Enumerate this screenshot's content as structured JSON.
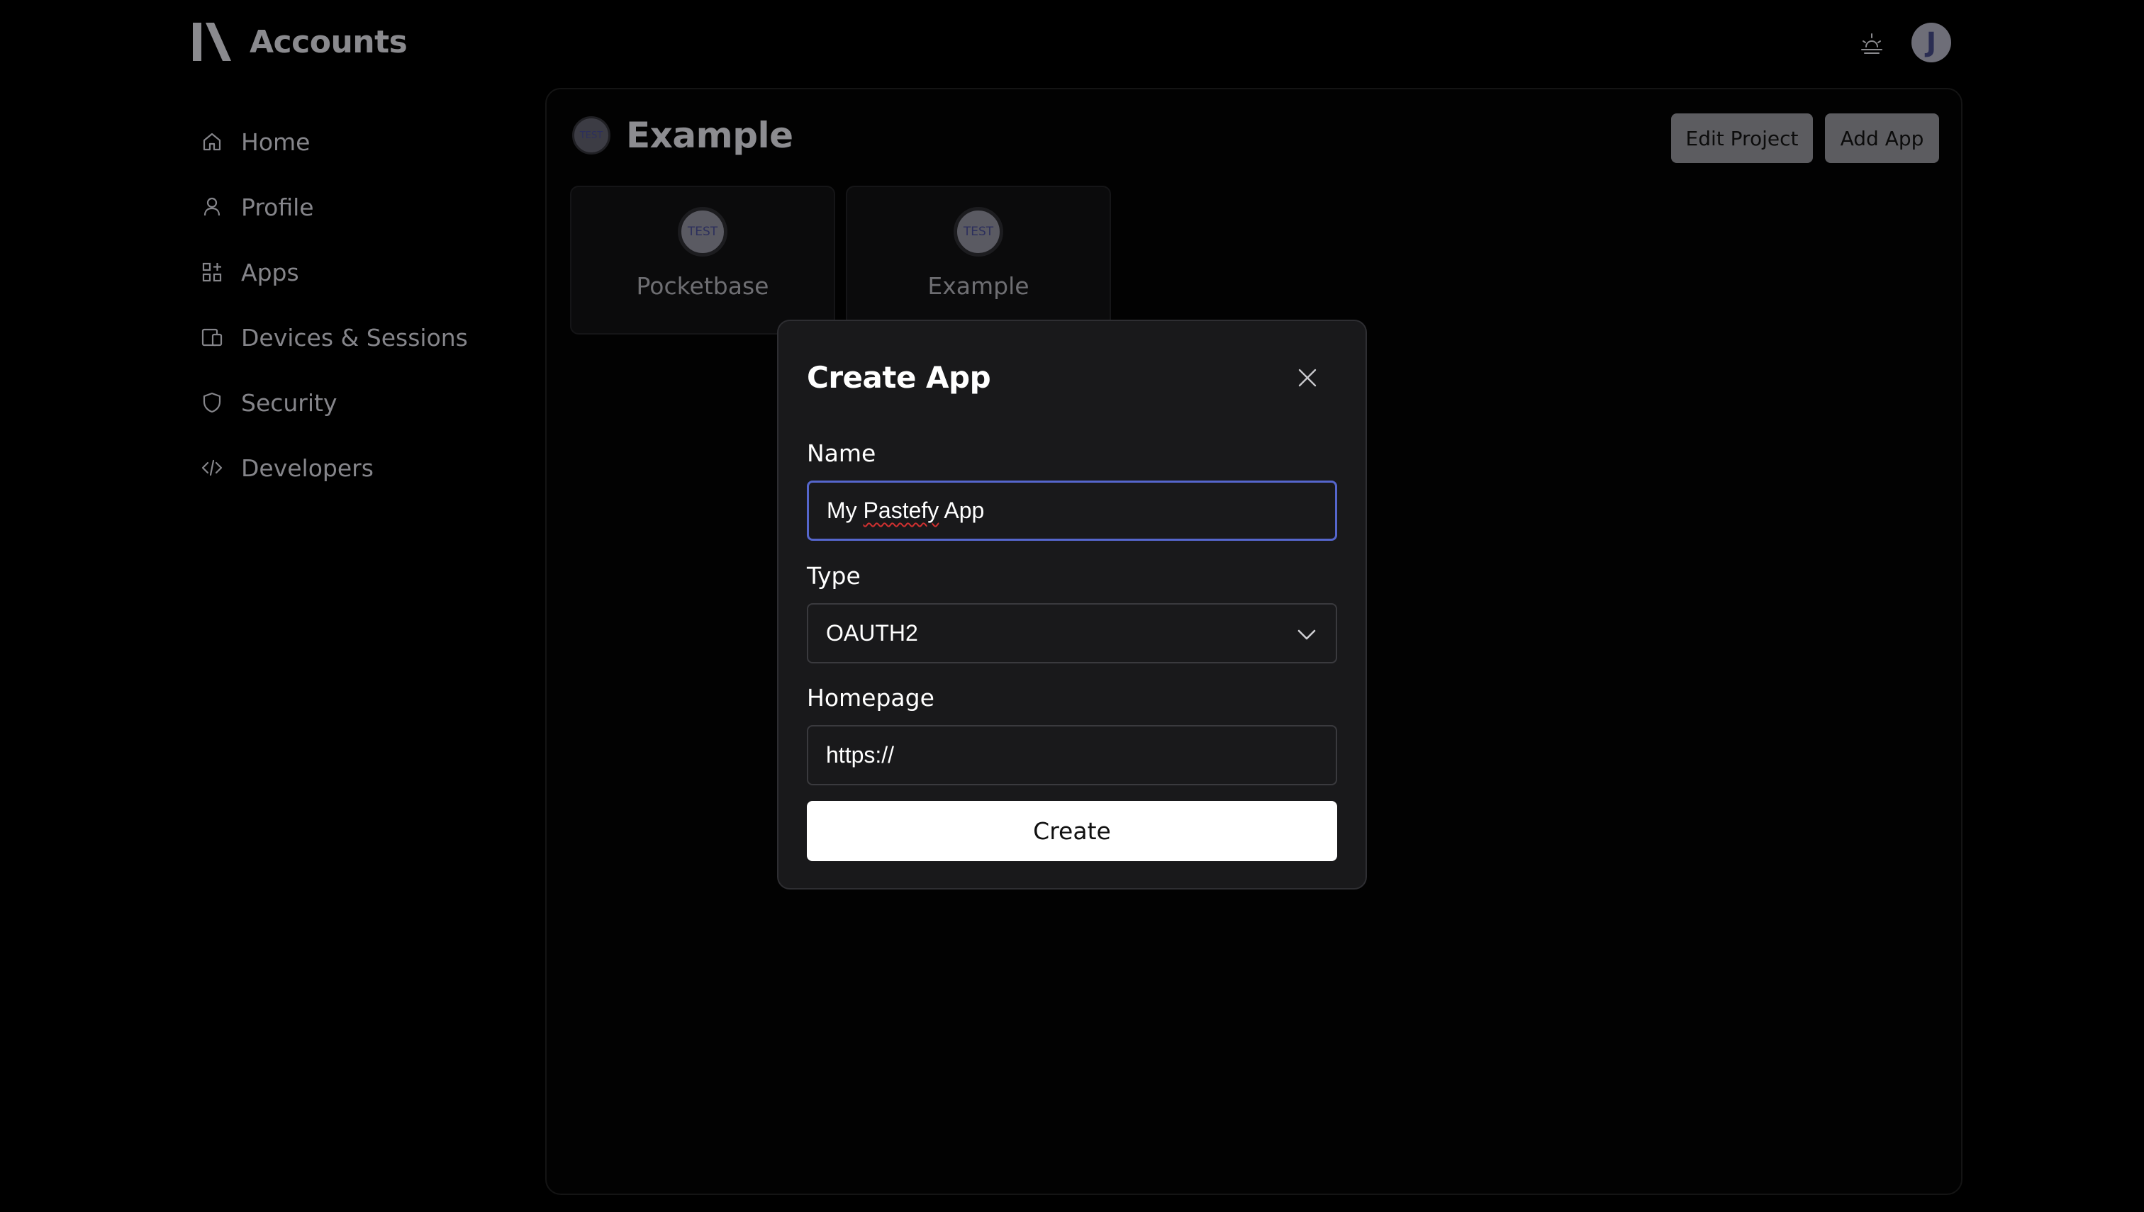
{
  "header": {
    "app_title": "Accounts",
    "logo_icon": "logo-mark-icon",
    "theme_icon": "theme-toggle-icon",
    "avatar_initial": "J"
  },
  "sidebar": {
    "items": [
      {
        "label": "Home",
        "icon": "home-icon"
      },
      {
        "label": "Profile",
        "icon": "user-icon"
      },
      {
        "label": "Apps",
        "icon": "apps-icon"
      },
      {
        "label": "Devices & Sessions",
        "icon": "devices-icon"
      },
      {
        "label": "Security",
        "icon": "shield-icon"
      },
      {
        "label": "Developers",
        "icon": "code-icon"
      }
    ]
  },
  "project": {
    "avatar_text": "TEST",
    "title": "Example",
    "edit_label": "Edit Project",
    "add_label": "Add App",
    "apps": [
      {
        "name": "Pocketbase",
        "avatar_text": "TEST"
      },
      {
        "name": "Example",
        "avatar_text": "TEST"
      }
    ]
  },
  "modal": {
    "title": "Create App",
    "name_label": "Name",
    "name_value_prefix": "My ",
    "name_value_misspelled": "Pastefy",
    "name_value_suffix": " App",
    "type_label": "Type",
    "type_value": "OAUTH2",
    "homepage_label": "Homepage",
    "homepage_value": "https://",
    "create_label": "Create"
  },
  "colors": {
    "background": "#000000",
    "modal_bg": "#19191b",
    "focus_border": "#5566cc",
    "primary_button": "#ffffff",
    "secondary_button": "#5c5c60"
  }
}
